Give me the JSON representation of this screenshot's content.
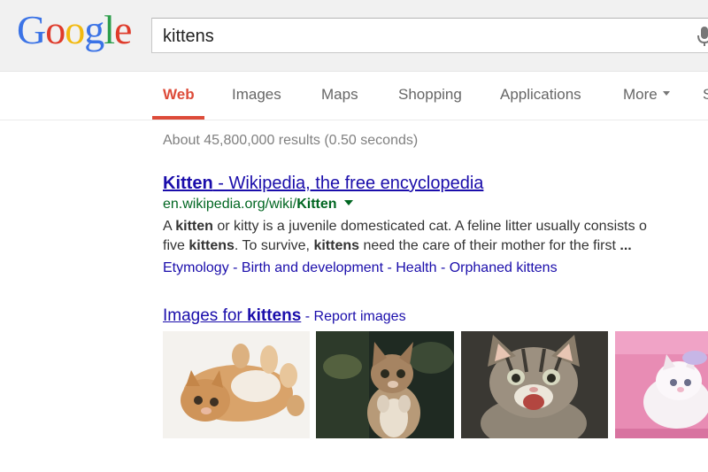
{
  "logo": {
    "letters": [
      "G",
      "o",
      "o",
      "g",
      "l",
      "e"
    ],
    "colors": [
      "#4285f4",
      "#ea4335",
      "#fbbc05",
      "#4285f4",
      "#34a853",
      "#ea4335"
    ]
  },
  "search": {
    "value": "kittens",
    "mic_icon": "microphone-icon"
  },
  "nav": {
    "tabs": [
      "Web",
      "Images",
      "Maps",
      "Shopping",
      "Applications",
      "More",
      "S"
    ],
    "active": "Web",
    "active_color": "#dd4b39"
  },
  "stats": "About 45,800,000 results (0.50 seconds)",
  "result": {
    "title": "Kitten - Wikipedia, the free encyclopedia",
    "url_prefix": "en.wikipedia.org/wiki/",
    "url_bold": "Kitten",
    "snippet": {
      "l1_a": "A ",
      "l1_b": "kitten",
      "l1_c": " or kitty is a juvenile domesticated cat. A feline litter usually consists o",
      "l2_a": "five ",
      "l2_b": "kittens",
      "l2_c": ". To survive, ",
      "l2_d": "kittens",
      "l2_e": " need the care of their mother for the first ",
      "l2_f": "..."
    },
    "sitelinks": [
      "Etymology",
      "Birth and development",
      "Health",
      "Orphaned kittens"
    ],
    "sitelink_sep": " - "
  },
  "images": {
    "heading_prefix": "Images for ",
    "heading_bold": "kittens",
    "report_sep": " - ",
    "report": "Report images",
    "thumbnails": [
      "kitten-photo",
      "kitten-photo",
      "kitten-photo",
      "kitten-photo"
    ]
  }
}
